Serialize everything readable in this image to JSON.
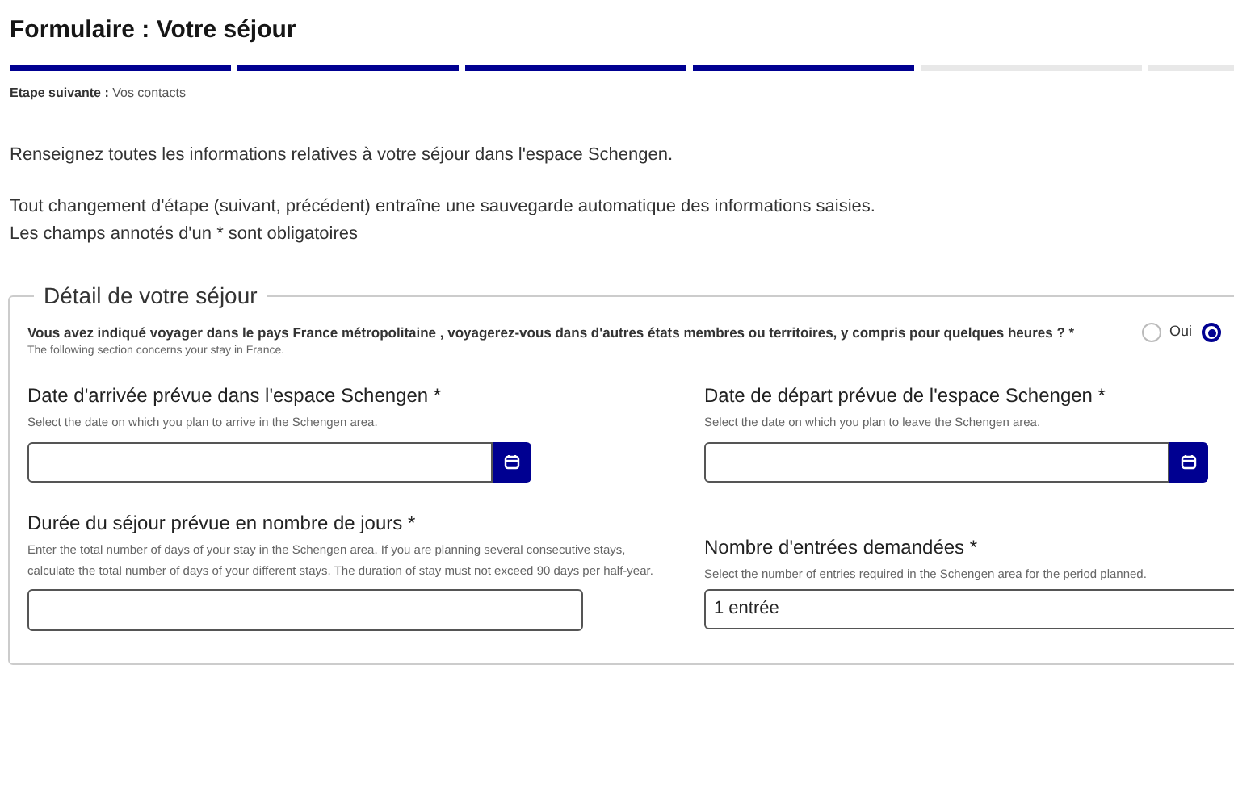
{
  "title": "Formulaire : Votre séjour",
  "progress": [
    {
      "done": true
    },
    {
      "done": true
    },
    {
      "done": true
    },
    {
      "done": true
    },
    {
      "done": false
    },
    {
      "done": false
    }
  ],
  "next_step": {
    "label": "Etape suivante :",
    "value": "Vos contacts"
  },
  "intro": [
    "Renseignez toutes les informations relatives à votre séjour dans l'espace Schengen.",
    "Tout changement d'étape (suivant, précédent) entraîne une sauvegarde automatique des informations saisies.",
    "Les champs annotés d'un * sont obligatoires"
  ],
  "section": {
    "legend": "Détail de votre séjour",
    "question": {
      "text": "Vous avez indiqué voyager dans le pays France métropolitaine , voyagerez-vous dans d'autres états membres ou territoires, y compris pour quelques heures ? *",
      "hint": "The following section concerns your stay in France.",
      "options": [
        {
          "label": "Oui",
          "selected": false
        },
        {
          "selected": true
        }
      ]
    },
    "fields": [
      {
        "kind": "date",
        "label": "Date d'arrivée prévue dans l'espace Schengen *",
        "hint": "Select the date on which you plan to arrive in the Schengen area."
      },
      {
        "kind": "date",
        "label": "Date de départ prévue de l'espace Schengen *",
        "hint": "Select the date on which you plan to leave the Schengen area."
      },
      {
        "kind": "text",
        "label": "Durée du séjour prévue en nombre de jours *",
        "hint": "Enter the total number of days of your stay in the Schengen area. If you are planning several consecutive stays, calculate the total number of days of your different stays. The duration of stay must not exceed 90 days per half-year."
      },
      {
        "kind": "select",
        "label": "Nombre d'entrées demandées *",
        "hint": "Select the number of entries required in the Schengen area for the period planned.",
        "value": "1 entrée"
      }
    ]
  }
}
